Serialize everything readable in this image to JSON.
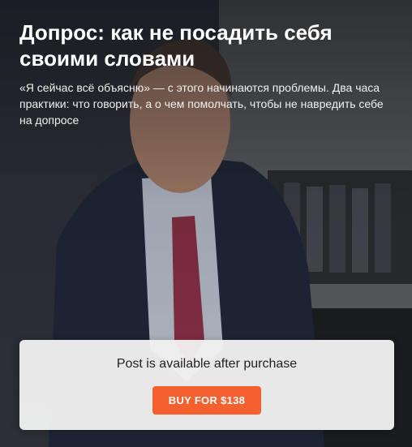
{
  "post": {
    "title": "Допрос: как не посадить себя своими словами",
    "subtitle": "«Я сейчас всё объясню» — с этого начинаются проблемы. Два часа практики: что говорить, а о чем помолчать, чтобы не навредить себе на допросе"
  },
  "paywall": {
    "message": "Post is available after purchase",
    "buy_label": "BUY FOR $138"
  },
  "colors": {
    "accent": "#f4612f",
    "paywall_bg": "#f0f0f0"
  }
}
